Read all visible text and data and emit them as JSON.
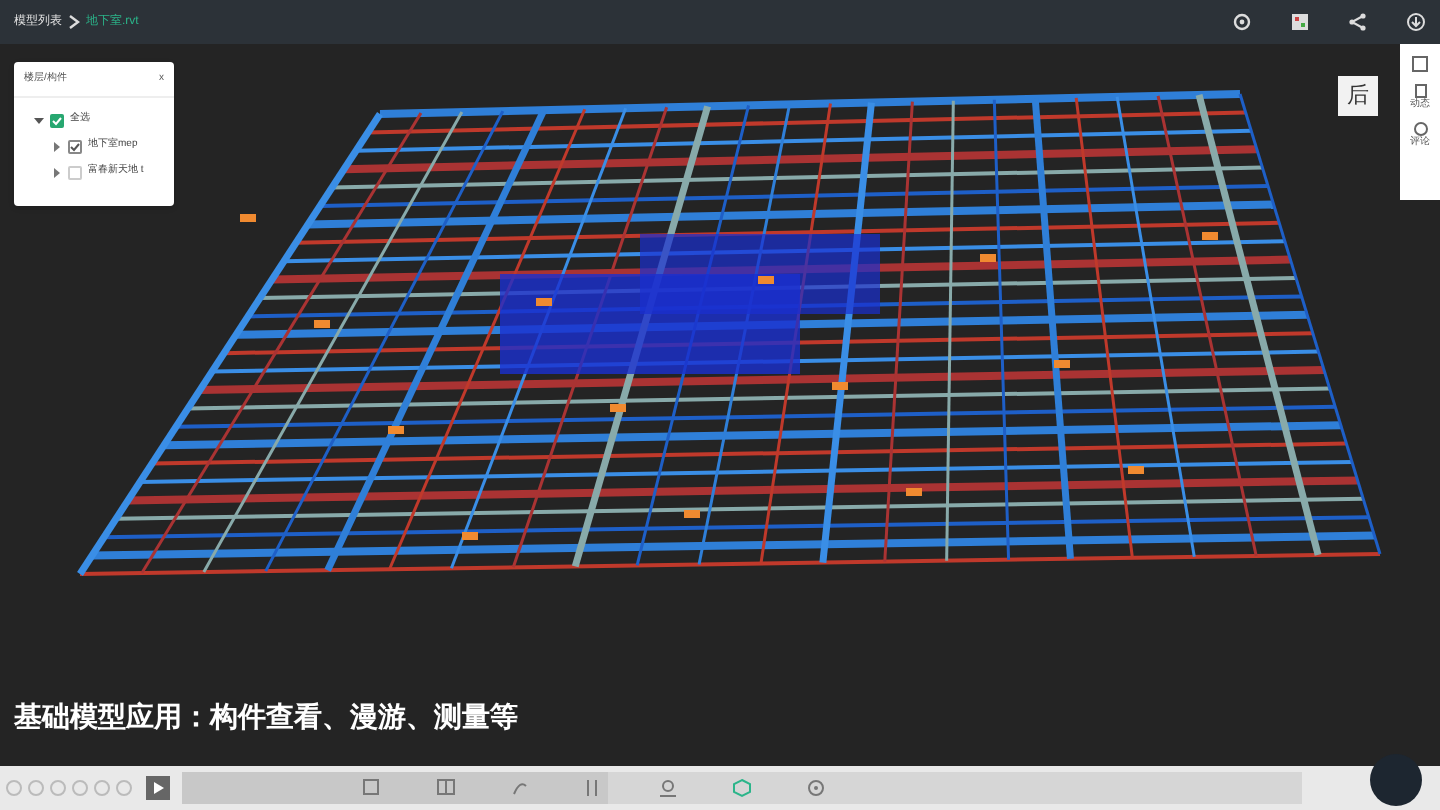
{
  "breadcrumb": [
    {
      "label": "模型列表",
      "selected": false
    },
    {
      "label": "地下室.rvt",
      "selected": true
    }
  ],
  "tree_panel": {
    "title": "楼层/构件",
    "close": "x",
    "items": [
      {
        "label": "全选",
        "checked": true,
        "expanded": true,
        "children": [
          {
            "label": "地下室mep",
            "checked": true,
            "expanded": false
          },
          {
            "label": "富春新天地 t",
            "checked": false,
            "expanded": false
          }
        ]
      }
    ]
  },
  "view_button": "后",
  "side_panel": [
    {
      "kind": "icon"
    },
    {
      "kind": "labeled",
      "label": "动态"
    },
    {
      "kind": "labeled",
      "label": "评论"
    }
  ],
  "caption": "基础模型应用：构件查看、漫游、测量等",
  "player": {
    "level": 0.38
  },
  "toolbar": [
    {
      "selected": false
    },
    {
      "selected": false
    },
    {
      "selected": false
    },
    {
      "selected": false
    },
    {
      "selected": false
    },
    {
      "selected": true
    },
    {
      "selected": false
    }
  ]
}
